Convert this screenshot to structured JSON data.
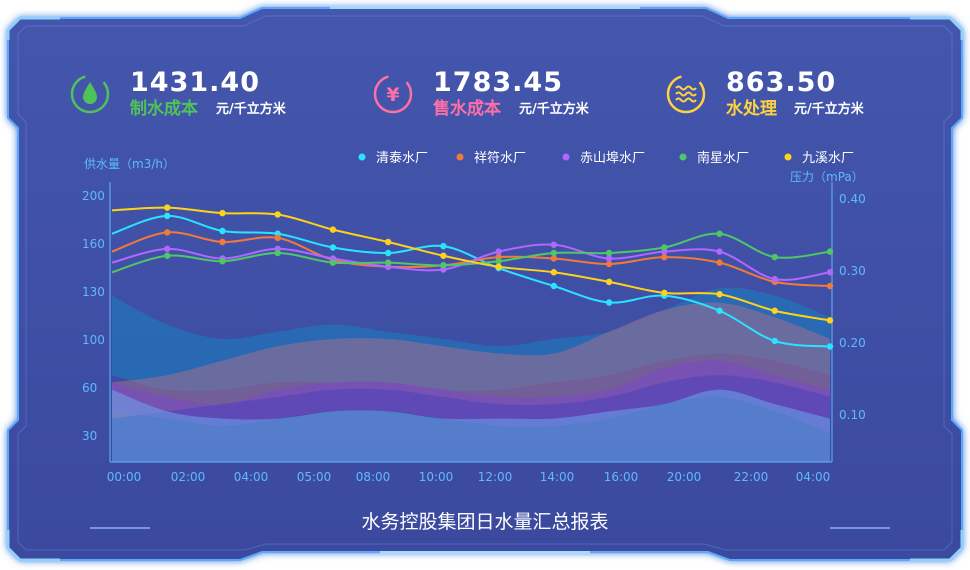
{
  "kpis": [
    {
      "value": "1431.40",
      "label": "制水成本",
      "unit": "元/千立方米",
      "color": "#4fc35a",
      "icon": "water-drop-icon"
    },
    {
      "value": "1783.45",
      "label": "售水成本",
      "unit": "元/千立方米",
      "color": "#ff6fa6",
      "icon": "yen-icon"
    },
    {
      "value": "863.50",
      "label": "水处理",
      "unit": "元/千立方米",
      "color": "#ffd23e",
      "icon": "waves-icon"
    }
  ],
  "title": "水务控股集团日水量汇总报表",
  "colors": {
    "panel": "#3d4fa7",
    "frame": "#59a8ff",
    "axis": "#5fb9ff"
  },
  "chart_data": {
    "type": "line",
    "ylabel": "供水量（m3/h）",
    "y2label": "压力（mPa）",
    "ylim": [
      10,
      210
    ],
    "y2lim": [
      0.04,
      0.42
    ],
    "y_ticks": [
      "200",
      "160",
      "130",
      "100",
      "60",
      "30"
    ],
    "y2_ticks": [
      "0.40",
      "0.30",
      "0.20",
      "0.10"
    ],
    "x_labels": [
      "00:00",
      "02:00",
      "04:00",
      "05:00",
      "08:00",
      "10:00",
      "12:00",
      "14:00",
      "16:00",
      "20:00",
      "22:00",
      "04:00"
    ],
    "series": [
      {
        "name": "清泰水厂",
        "color": "#29e3ff",
        "values": [
          176,
          189,
          178,
          176,
          166,
          162,
          167,
          151,
          138,
          126,
          131,
          120,
          98,
          94
        ]
      },
      {
        "name": "祥符水厂",
        "color": "#ef7a3a",
        "values": [
          163,
          177,
          170,
          173,
          157,
          152,
          153,
          159,
          158,
          154,
          159,
          155,
          141,
          138
        ]
      },
      {
        "name": "赤山埠水厂",
        "color": "#b266ff",
        "values": [
          155,
          165,
          158,
          165,
          158,
          152,
          150,
          163,
          168,
          158,
          163,
          163,
          143,
          148
        ]
      },
      {
        "name": "南星水厂",
        "color": "#4fc766",
        "values": [
          148,
          160,
          156,
          162,
          155,
          155,
          153,
          156,
          162,
          162,
          166,
          176,
          159,
          163
        ]
      },
      {
        "name": "九溪水厂",
        "color": "#ffd21a",
        "values": [
          193,
          195,
          191,
          190,
          179,
          170,
          160,
          152,
          148,
          141,
          133,
          132,
          120,
          113
        ]
      }
    ],
    "pressure_bands": [
      {
        "name": "band-teal",
        "color": "#1a7fbf",
        "upper": [
          0.27,
          0.23,
          0.21,
          0.22,
          0.23,
          0.22,
          0.21,
          0.2,
          0.21,
          0.22,
          0.25,
          0.28,
          0.27,
          0.24
        ],
        "lower": [
          0.16,
          0.14,
          0.14,
          0.15,
          0.15,
          0.15,
          0.14,
          0.14,
          0.15,
          0.16,
          0.18,
          0.19,
          0.18,
          0.16
        ]
      },
      {
        "name": "band-rose",
        "color": "#a0708f",
        "upper": [
          0.15,
          0.16,
          0.18,
          0.2,
          0.21,
          0.21,
          0.2,
          0.19,
          0.19,
          0.22,
          0.25,
          0.26,
          0.24,
          0.21
        ],
        "lower": [
          0.1,
          0.11,
          0.12,
          0.13,
          0.14,
          0.14,
          0.13,
          0.12,
          0.12,
          0.13,
          0.15,
          0.16,
          0.15,
          0.13
        ]
      },
      {
        "name": "band-violet",
        "color": "#7b47c9",
        "upper": [
          0.15,
          0.13,
          0.12,
          0.14,
          0.15,
          0.15,
          0.14,
          0.13,
          0.13,
          0.14,
          0.17,
          0.18,
          0.16,
          0.14
        ],
        "lower": [
          0.11,
          0.1,
          0.09,
          0.1,
          0.11,
          0.11,
          0.1,
          0.09,
          0.09,
          0.1,
          0.12,
          0.13,
          0.11,
          0.08
        ]
      },
      {
        "name": "band-blue",
        "color": "#6aa6ee",
        "upper": [
          0.14,
          0.11,
          0.1,
          0.1,
          0.11,
          0.11,
          0.1,
          0.1,
          0.1,
          0.11,
          0.12,
          0.14,
          0.12,
          0.1
        ],
        "lower": [
          0.04,
          0.04,
          0.04,
          0.04,
          0.04,
          0.04,
          0.04,
          0.04,
          0.04,
          0.04,
          0.04,
          0.04,
          0.04,
          0.04
        ]
      }
    ],
    "legend_position": "top-right",
    "grid": false
  }
}
